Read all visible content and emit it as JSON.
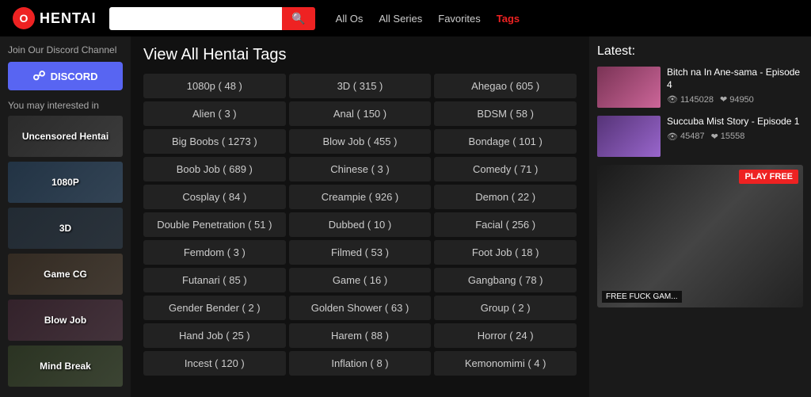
{
  "header": {
    "logo_letter": "O",
    "logo_text": "HENTAI",
    "search_placeholder": "",
    "nav": [
      {
        "label": "All Os",
        "active": false
      },
      {
        "label": "All Series",
        "active": false
      },
      {
        "label": "Favorites",
        "active": false
      },
      {
        "label": "Tags",
        "active": true
      }
    ]
  },
  "sidebar": {
    "discord_title": "Join Our Discord Channel",
    "discord_label": "DISCORD",
    "interested_title": "You may interested in",
    "items": [
      {
        "label": "Uncensored Hentai"
      },
      {
        "label": "1080P"
      },
      {
        "label": "3D"
      },
      {
        "label": "Game CG"
      },
      {
        "label": "Blow Job"
      },
      {
        "label": "Mind Break"
      }
    ]
  },
  "main": {
    "title": "View All Hentai Tags",
    "tags": [
      {
        "label": "1080p ( 48 )"
      },
      {
        "label": "3D ( 315 )"
      },
      {
        "label": "Ahegao ( 605 )"
      },
      {
        "label": "Alien ( 3 )"
      },
      {
        "label": "Anal ( 150 )"
      },
      {
        "label": "BDSM ( 58 )"
      },
      {
        "label": "Big Boobs ( 1273 )"
      },
      {
        "label": "Blow Job ( 455 )"
      },
      {
        "label": "Bondage ( 101 )"
      },
      {
        "label": "Boob Job ( 689 )"
      },
      {
        "label": "Chinese ( 3 )"
      },
      {
        "label": "Comedy ( 71 )"
      },
      {
        "label": "Cosplay ( 84 )"
      },
      {
        "label": "Creampie ( 926 )"
      },
      {
        "label": "Demon ( 22 )"
      },
      {
        "label": "Double Penetration ( 51 )"
      },
      {
        "label": "Dubbed ( 10 )"
      },
      {
        "label": "Facial ( 256 )"
      },
      {
        "label": "Femdom ( 3 )"
      },
      {
        "label": "Filmed ( 53 )"
      },
      {
        "label": "Foot Job ( 18 )"
      },
      {
        "label": "Futanari ( 85 )"
      },
      {
        "label": "Game ( 16 )"
      },
      {
        "label": "Gangbang ( 78 )"
      },
      {
        "label": "Gender Bender ( 2 )"
      },
      {
        "label": "Golden Shower ( 63 )"
      },
      {
        "label": "Group ( 2 )"
      },
      {
        "label": "Hand Job ( 25 )"
      },
      {
        "label": "Harem ( 88 )"
      },
      {
        "label": "Horror ( 24 )"
      },
      {
        "label": "Incest ( 120 )"
      },
      {
        "label": "Inflation ( 8 )"
      },
      {
        "label": "Kemonomimi ( 4 )"
      }
    ]
  },
  "right": {
    "title": "Latest:",
    "items": [
      {
        "name": "Bitch na In Ane-sama - Episode 4",
        "views": "1145028",
        "likes": "94950"
      },
      {
        "name": "Succuba Mist Story - Episode 1",
        "views": "45487",
        "likes": "15558"
      }
    ],
    "banner_play_label": "PLAY FREE",
    "banner_bottom_label": "FREE FUCK GAM...",
    "banner_play_label2": "PLAY FREE"
  }
}
